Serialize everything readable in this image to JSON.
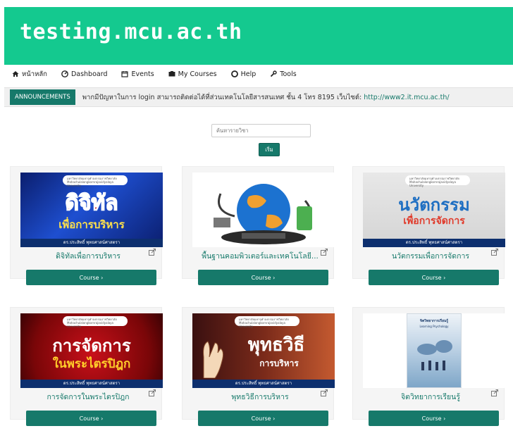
{
  "site": {
    "title": "testing.mcu.ac.th"
  },
  "nav": [
    {
      "label": "หน้าหลัก",
      "icon": "home-icon"
    },
    {
      "label": "Dashboard",
      "icon": "dashboard-icon"
    },
    {
      "label": "Events",
      "icon": "calendar-icon"
    },
    {
      "label": "My Courses",
      "icon": "courses-icon"
    },
    {
      "label": "Help",
      "icon": "help-icon"
    },
    {
      "label": "Tools",
      "icon": "wrench-icon"
    }
  ],
  "announcement": {
    "badge": "ANNOUNCEMENTS",
    "text": "พากมีปัญหาในการ login  สามารถติดต่อได้ที่ส่วนเทคโนโลยีสารสนเทศ ชั้น 4  โทร 8195  เว็บไซต์: ",
    "link": "http://www2.it.mcu.ac.th/"
  },
  "search": {
    "placeholder": "ค้นหารายวิชา",
    "button": "เริ่ม"
  },
  "courses": [
    {
      "title": "ดิจิทัลเพื่อการบริหาร",
      "button": "Course ›",
      "banner_main": "ดิจิทัล",
      "banner_sub": "เพื่อการบริหาร",
      "banner_univ": "มหาวิทยาลัยมหาจุฬาลงกรณราชวิทยาลัย Mahachulalongkornrajavidyalaya University",
      "author": "ดร.ประสิทธิ์ พุทธศาสน์ศาสตรา"
    },
    {
      "title": "พื้นฐานคอมพิวเตอร์และเทคโนโลยี...",
      "button": "Course ›"
    },
    {
      "title": "นวัตกรรมเพื่อการจัดการ",
      "button": "Course ›",
      "banner_main": "นวัตกรรม",
      "banner_sub": "เพื่อการจัดการ",
      "banner_univ": "มหาวิทยาลัยมหาจุฬาลงกรณราชวิทยาลัย Mahachulalongkornrajavidyalaya University",
      "author": "ดร.ประสิทธิ์ พุทธศาสน์ศาสตรา"
    },
    {
      "title": "การจัดการในพระไตรปิฎก",
      "button": "Course ›",
      "banner_main": "การจัดการ",
      "banner_sub": "ในพระไตรปิฎก",
      "banner_univ": "มหาวิทยาลัยมหาจุฬาลงกรณราชวิทยาลัย Mahachulalongkornrajavidyalaya University",
      "author": "ดร.ประสิทธิ์ พุทธศาสน์ศาสตรา"
    },
    {
      "title": "พุทธวิธีการบริหาร",
      "button": "Course ›",
      "banner_main": "พุทธวิธี",
      "banner_sub": "การบริหาร",
      "banner_univ": "มหาวิทยาลัยมหาจุฬาลงกรณราชวิทยาลัย Mahachulalongkornrajavidyalaya University",
      "author": "ดร.ประสิทธิ์ พุทธศาสน์ศาสตรา"
    },
    {
      "title": "จิตวิทยาการเรียนรู้",
      "button": "Course ›",
      "banner_main": "จิตวิทยาการเรียนรู้",
      "banner_sub": "Learning Psychology"
    }
  ],
  "colors": {
    "header": "#14c98f",
    "accent": "#16796a"
  }
}
